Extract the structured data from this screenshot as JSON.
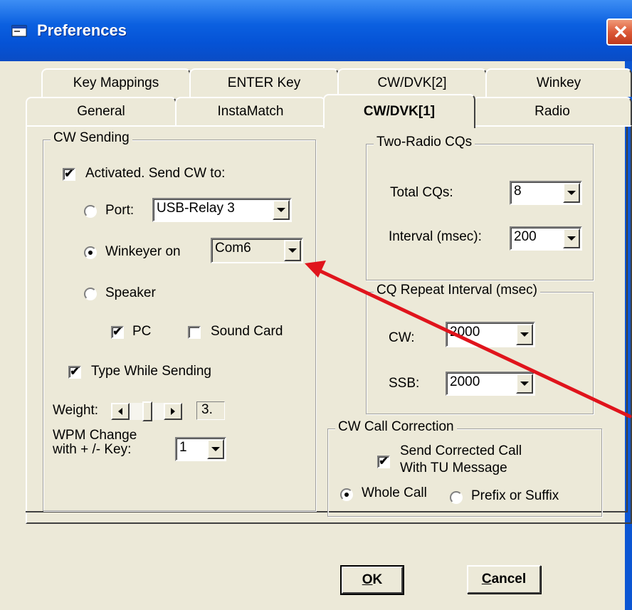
{
  "window": {
    "title": "Preferences",
    "close_icon": "close-icon",
    "title_icon": "window-icon"
  },
  "tabs": {
    "row_back": [
      "Key Mappings",
      "ENTER Key",
      "CW/DVK[2]",
      "Winkey"
    ],
    "row_front": [
      "General",
      "InstaMatch",
      "CW/DVK[1]",
      "Radio"
    ],
    "selected": "CW/DVK[1]"
  },
  "cw_sending": {
    "legend": "CW Sending",
    "activated": {
      "label": "Activated. Send CW to:",
      "checked": true
    },
    "port": {
      "label": "Port:",
      "selected": false,
      "value": "USB-Relay 3"
    },
    "winkeyer": {
      "label": "Winkeyer on",
      "selected": true,
      "value": "Com6"
    },
    "speaker": {
      "label": "Speaker",
      "selected": false
    },
    "pc": {
      "label": "PC",
      "checked": true
    },
    "sound_card": {
      "label": "Sound Card",
      "checked": false
    },
    "type_while_sending": {
      "label": "Type While Sending",
      "checked": true
    },
    "weight": {
      "label": "Weight:",
      "value": "3."
    },
    "wpm_change": {
      "label_line1": "WPM  Change",
      "label_line2": "with  + /-  Key:",
      "value": "1"
    }
  },
  "two_radio": {
    "legend": "Two-Radio CQs",
    "total_cqs": {
      "label": "Total CQs:",
      "value": "8"
    },
    "interval": {
      "label": "Interval (msec):",
      "value": "200"
    }
  },
  "cq_repeat": {
    "legend": "CQ Repeat Interval (msec)",
    "cw": {
      "label": "CW:",
      "value": "2000"
    },
    "ssb": {
      "label": "SSB:",
      "value": "2000"
    }
  },
  "call_correction": {
    "legend": "CW Call Correction",
    "send_corrected": {
      "label_line1": "Send Corrected Call",
      "label_line2": "With TU Message",
      "checked": true
    },
    "whole_call": {
      "label": "Whole Call",
      "selected": true
    },
    "prefix_suffix": {
      "label": "Prefix or Suffix",
      "selected": false
    }
  },
  "buttons": {
    "ok": {
      "accel": "O",
      "rest": "K"
    },
    "cancel": {
      "accel": "C",
      "rest": "ancel"
    }
  },
  "annotation": {
    "color": "#e0141c"
  },
  "check_glyph": "✔"
}
